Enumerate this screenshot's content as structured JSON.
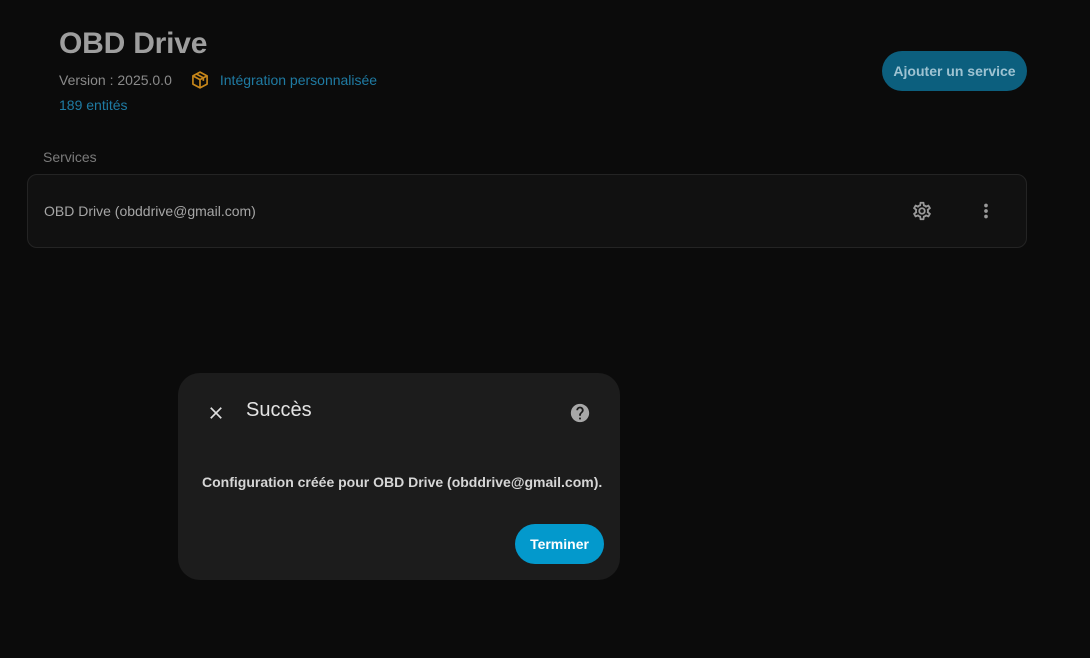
{
  "integration": {
    "title": "OBD Drive",
    "version": "Version : 2025.0.0",
    "custom_label": "Intégration personnalisée",
    "entities": "189 entités",
    "custom_icon": "package-icon"
  },
  "actions": {
    "add_service": "Ajouter un service"
  },
  "services": {
    "section_label": "Services",
    "items": [
      {
        "name": "OBD Drive (obddrive@gmail.com)",
        "settings_icon": "gear-icon",
        "menu_icon": "dots-vertical-icon"
      }
    ]
  },
  "dialog": {
    "title": "Succès",
    "message": "Configuration créée pour OBD Drive (obddrive@gmail.com).",
    "finish": "Terminer",
    "close_icon": "close-icon",
    "help_icon": "help-circle-icon"
  },
  "colors": {
    "background": "#0b0b0b",
    "accent": "#0399cc",
    "link": "#1f7ba3",
    "custom_icon": "#c8871a",
    "dialog_bg": "#1c1c1c"
  }
}
